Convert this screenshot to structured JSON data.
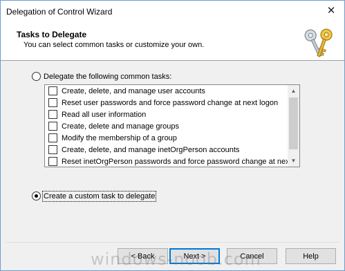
{
  "window": {
    "title": "Delegation of Control Wizard",
    "close_glyph": "✕"
  },
  "header": {
    "title": "Tasks to Delegate",
    "subtitle": "You can select common tasks or customize your own.",
    "icon": "keys-icon"
  },
  "options": {
    "common_label": "Delegate the following common tasks:",
    "common_selected": false,
    "custom_label": "Create a custom task to delegate",
    "custom_selected": true
  },
  "tasks": [
    {
      "label": "Create, delete, and manage user accounts",
      "checked": false
    },
    {
      "label": "Reset user passwords and force password change at next logon",
      "checked": false
    },
    {
      "label": "Read all user information",
      "checked": false
    },
    {
      "label": "Create, delete and manage groups",
      "checked": false
    },
    {
      "label": "Modify the membership of a group",
      "checked": false
    },
    {
      "label": "Create, delete, and manage inetOrgPerson accounts",
      "checked": false
    },
    {
      "label": "Reset inetOrgPerson passwords and force password change at next lo",
      "checked": false
    }
  ],
  "buttons": {
    "back": "< Back",
    "next": "Next >",
    "cancel": "Cancel",
    "help": "Help"
  },
  "watermark": "windows-noob.com"
}
